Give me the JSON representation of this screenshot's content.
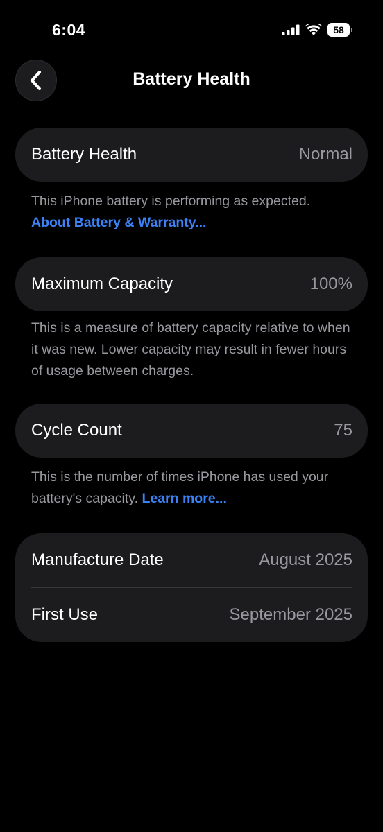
{
  "status_bar": {
    "time": "6:04",
    "battery_level": "58",
    "signal_icon": "cellular-signal-icon",
    "wifi_icon": "wifi-icon"
  },
  "nav": {
    "title": "Battery Health",
    "back_icon": "chevron-left-icon"
  },
  "battery_health": {
    "label": "Battery Health",
    "value": "Normal",
    "footnote": "This iPhone battery is performing as expected.",
    "link": "About Battery & Warranty..."
  },
  "maximum_capacity": {
    "label": "Maximum Capacity",
    "value": "100%",
    "footnote": "This is a measure of battery capacity relative to when it was new. Lower capacity may result in fewer hours of usage between charges."
  },
  "cycle_count": {
    "label": "Cycle Count",
    "value": "75",
    "footnote": "This is the number of times iPhone has used your battery's capacity.",
    "link": "Learn more..."
  },
  "dates": {
    "manufacture_label": "Manufacture Date",
    "manufacture_value": "August 2025",
    "first_use_label": "First Use",
    "first_use_value": "September 2025"
  },
  "colors": {
    "background": "#000000",
    "card": "#1c1c1e",
    "secondary_text": "#98989f",
    "link": "#3b82f6"
  }
}
